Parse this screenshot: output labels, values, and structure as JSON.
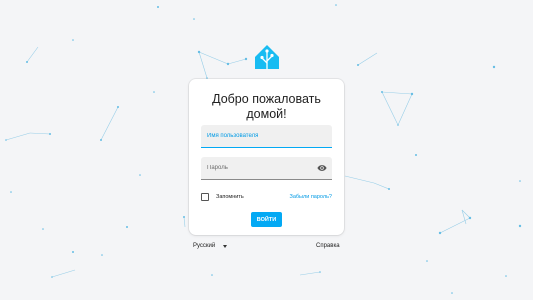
{
  "login": {
    "title_line1": "Добро пожаловать",
    "title_line2": "домой!",
    "username_placeholder": "Имя пользователя",
    "password_placeholder": "Пароль",
    "remember_label": "Запомнить",
    "forgot_label": "Забыли пароль?",
    "login_button": "ВОЙТИ"
  },
  "footer": {
    "language": "Русский",
    "help": "Справка"
  },
  "colors": {
    "accent": "#03a9f4",
    "background": "#f4f5f7"
  },
  "icons": {
    "logo": "home-assistant-logo-icon",
    "show_password": "eye-icon",
    "language_dropdown": "caret-down-icon"
  }
}
